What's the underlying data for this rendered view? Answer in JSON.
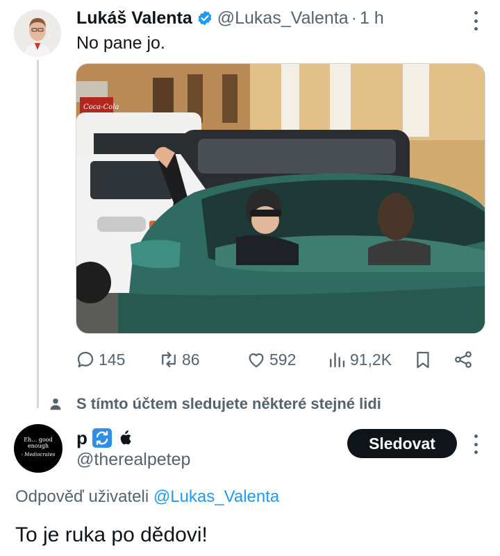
{
  "tweet": {
    "author_name": "Lukáš Valenta",
    "author_handle": "@Lukas_Valenta",
    "separator": "·",
    "time": "1 h",
    "text": "No pane jo.",
    "image_watermark": "Coca-Cola",
    "stats": {
      "replies": "145",
      "retweets": "86",
      "likes": "592",
      "views": "91,2K"
    },
    "icons": {
      "verified": "verified-badge-icon",
      "reply": "reply-icon",
      "retweet": "retweet-icon",
      "like": "heart-icon",
      "views": "views-icon",
      "bookmark": "bookmark-icon",
      "share": "share-icon",
      "more": "more-options-icon"
    }
  },
  "social_context": {
    "text": "S tímto účtem sledujete některé stejné lidi",
    "icon": "person-icon"
  },
  "reply": {
    "avatar_text_top": "Eh… good enough",
    "avatar_text_bottom": "- Mediocrates",
    "author_name": "p",
    "name_icons": [
      "repeat-emoji-icon",
      "apple-icon"
    ],
    "author_handle": "@therealpetep",
    "follow_label": "Sledovat",
    "replying_to_prefix": "Odpověď uživateli",
    "replying_to_handle": "@Lukas_Valenta",
    "text": "To je ruka po dědovi!"
  },
  "colors": {
    "text_primary": "#0f1419",
    "text_secondary": "#536471",
    "accent": "#1d9bf0",
    "verified": "#1d9bf0",
    "thread_line": "#cfd9de",
    "follow_bg": "#0f1419"
  }
}
